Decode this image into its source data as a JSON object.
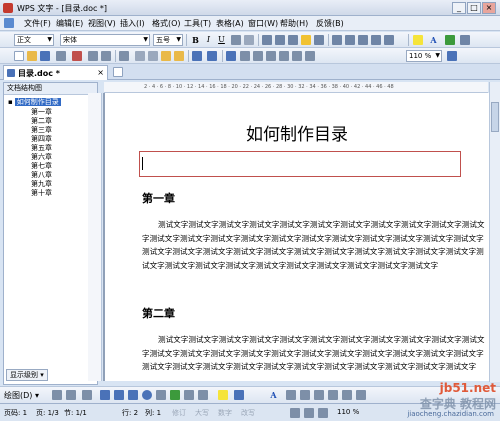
{
  "window": {
    "title": "WPS 文字 - [目录.doc *]",
    "min": "_",
    "max": "□",
    "close": "×"
  },
  "menu": [
    "文件(F)",
    "编辑(E)",
    "视图(V)",
    "插入(I)",
    "格式(O)",
    "工具(T)",
    "表格(A)",
    "窗口(W)",
    "帮助(H)",
    "反馈(B)"
  ],
  "toolbar": {
    "style_value": "正文",
    "font_value": "宋体",
    "size_value": "五号",
    "bold": "B",
    "italic": "I",
    "underline": "U",
    "zoom_value": "110 %"
  },
  "tabs": {
    "doc_tab": "目录.doc *"
  },
  "sidebar": {
    "header": "文档结构图",
    "root": "如何制作目录",
    "items": [
      "第一章",
      "第二章",
      "第三章",
      "第四章",
      "第五章",
      "第六章",
      "第七章",
      "第八章",
      "第九章",
      "第十章"
    ],
    "display_level": "显示级别 ▾"
  },
  "ruler_ticks": "2 · 4 · 6 · 8 · 10 · 12 · 14 · 16 · 18 · 20 · 22 · 24 · 26 · 28 · 30 · 32 · 34 · 36 · 38 · 40 · 42 · 44 · 46 · 48",
  "document": {
    "title": "如何制作目录",
    "chapters": [
      {
        "heading": "第一章",
        "body": "测试文字测试文字测试文字测试文字测试文字测试文字测试文字测试文字测试文字测试文字测试文字测试文字测试文字测试文字测试文字测试文字测试文字测试文字测试文字测试文字测试文字测试文字测试文字测试文字测试文字测试文字测试文字测试文字测试文字测试文字测试文字测试文字测试文字测试文字测试文字测试文字测试文字测试文字测试文字测试文字测试文字测试文字测试文字"
      },
      {
        "heading": "第二章",
        "body": "测试文字测试文字测试文字测试文字测试文字测试文字测试文字测试文字测试文字测试文字测试文字测试文字测试文字测试文字测试文字测试文字测试文字测试文字测试文字测试文字测试文字测试文字测试文字测试文字测试文字测试文字测试文字测试文字测试文字测试文字测试文字测试文字测试文字"
      }
    ]
  },
  "drawbar": {
    "draw_label": "绘图(D) ▾"
  },
  "status": {
    "page_no": "页码: 1",
    "page": "页: 1/3",
    "section": "节: 1/1",
    "row": "行: 2",
    "col": "列: 1",
    "rev": "修订",
    "caps": "大写",
    "num": "数字",
    "ovr": "改写",
    "zoom": "110 %"
  },
  "watermark": {
    "line1": "jb51.net",
    "line2": "查字典 教程网",
    "line3": "jiaocheng.chazidian.com"
  },
  "colors": {
    "accent": "#316ac5",
    "toc_border": "#c0504d",
    "chrome": "#d8e4f3"
  }
}
